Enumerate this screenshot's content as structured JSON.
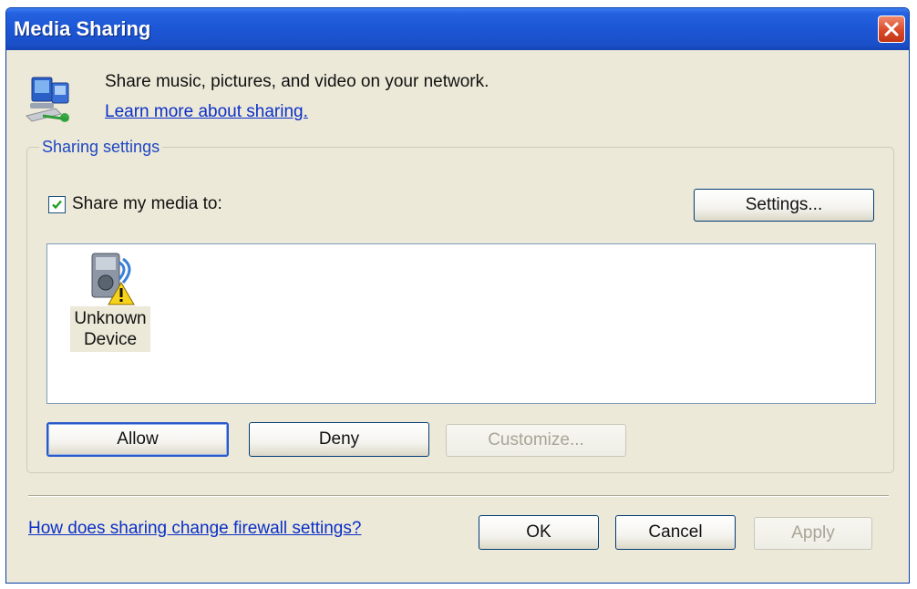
{
  "window": {
    "title": "Media Sharing"
  },
  "header": {
    "description": "Share music, pictures, and video on your network.",
    "learn_more_link": "Learn more about sharing."
  },
  "sharing_settings": {
    "group_label": "Sharing settings",
    "share_checkbox": {
      "label": "Share my media to:",
      "checked": true
    },
    "settings_button": "Settings...",
    "devices": [
      {
        "name": "Unknown Device",
        "line1": "Unknown",
        "line2": "Device",
        "icon": "device-warning-icon"
      }
    ],
    "allow_button": "Allow",
    "deny_button": "Deny",
    "customize_button": "Customize..."
  },
  "footer": {
    "firewall_link": "How does sharing change firewall settings?",
    "ok_button": "OK",
    "cancel_button": "Cancel",
    "apply_button": "Apply"
  },
  "colors": {
    "titlebar": "#1c56d4",
    "dialog_background": "#ece9d8",
    "link": "#0b2fc8",
    "group_label": "#1f47c4"
  }
}
